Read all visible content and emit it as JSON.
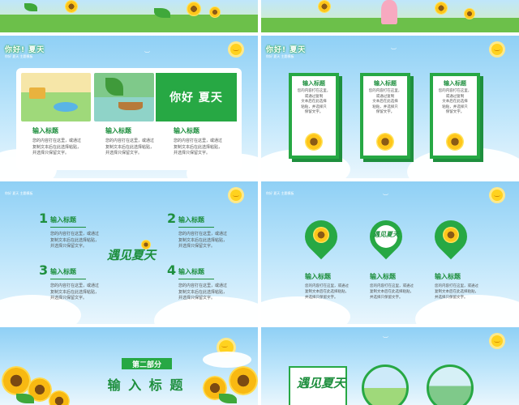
{
  "brand": {
    "name": "你好! 夏天",
    "tagline": "你好 夏天 主题模板"
  },
  "slide2": {
    "hero_title": "你好 夏天",
    "cols": [
      {
        "title": "输入标题",
        "body": [
          "您的内容打在这里，或通过",
          "复制文本后在此选择粘贴，",
          "并选择只保留文字。"
        ]
      },
      {
        "title": "输入标题",
        "body": [
          "您的内容打在这里，或通过",
          "复制文本后在此选择粘贴，",
          "并选择只保留文字。"
        ]
      },
      {
        "title": "输入标题",
        "body": [
          "您的内容打在这里，或通过",
          "复制文本后在此选择粘贴，",
          "并选择只保留文字。"
        ]
      }
    ]
  },
  "slide3": {
    "cards": [
      {
        "title": "输入标题",
        "body": [
          "您的内容打在这里，",
          "或通过复制",
          "文本后在此选择",
          "粘贴，并选择只",
          "保留文字。"
        ]
      },
      {
        "title": "输入标题",
        "body": [
          "您的内容打在这里，",
          "或通过复制",
          "文本后在此选择",
          "粘贴，并选择只",
          "保留文字。"
        ]
      },
      {
        "title": "输入标题",
        "body": [
          "您的内容打在这里，",
          "或通过复制",
          "文本后在此选择",
          "粘贴，并选择只",
          "保留文字。"
        ]
      }
    ]
  },
  "slide4": {
    "logo": "遇见夏天",
    "items": [
      {
        "num": "1",
        "title": "输入标题",
        "body": [
          "您的内容打在这里，或通过",
          "复制文本后在此选择粘贴，",
          "并选择只保留文字。"
        ]
      },
      {
        "num": "2",
        "title": "输入标题",
        "body": [
          "您的内容打在这里，或通过",
          "复制文本后在此选择粘贴，",
          "并选择只保留文字。"
        ]
      },
      {
        "num": "3",
        "title": "输入标题",
        "body": [
          "您的内容打在这里，或通过",
          "复制文本后在此选择粘贴，",
          "并选择只保留文字。"
        ]
      },
      {
        "num": "4",
        "title": "输入标题",
        "body": [
          "您的内容打在这里，或通过",
          "复制文本后在此选择粘贴，",
          "并选择只保留文字。"
        ]
      }
    ]
  },
  "slide5": {
    "pin_logo": "遇见夏天",
    "cols": [
      {
        "title": "输入标题",
        "body": [
          "您的内容打在这里，或通过",
          "复制文本后在此选择粘贴，",
          "并选择只保留文字。"
        ]
      },
      {
        "title": "输入标题",
        "body": [
          "您的内容打在这里，或通过",
          "复制文本后在此选择粘贴，",
          "并选择只保留文字。"
        ]
      },
      {
        "title": "输入标题",
        "body": [
          "您的内容打在这里，或通过",
          "复制文本后在此选择粘贴，",
          "并选择只保留文字。"
        ]
      }
    ]
  },
  "slide6": {
    "part": "第二部分",
    "title": "输 入 标 题"
  },
  "slide7": {
    "logo": "遇见夏天"
  },
  "colors": {
    "green": "#27a844",
    "sky": "#8fd0f5",
    "sun": "#ffd21f"
  }
}
